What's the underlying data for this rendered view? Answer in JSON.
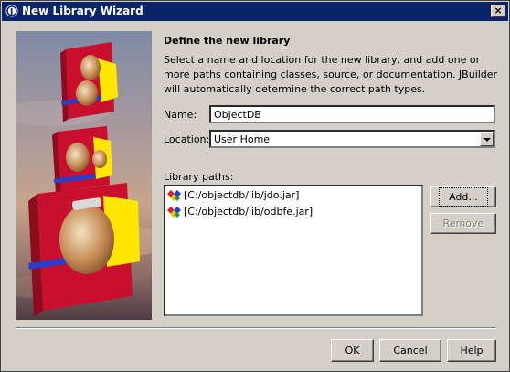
{
  "window": {
    "title": "New Library Wizard"
  },
  "page": {
    "heading": "Define the new library",
    "description": "Select a name and location for the new library, and add one or more paths containing classes, source, or documentation. JBuilder will automatically determine the correct path types."
  },
  "form": {
    "name_label": "Name:",
    "name_value": "ObjectDB",
    "location_label": "Location:",
    "location_value": "User Home"
  },
  "library_paths": {
    "label": "Library paths:",
    "items": [
      {
        "path": "[C:/objectdb/lib/jdo.jar]"
      },
      {
        "path": "[C:/objectdb/lib/odbfe.jar]"
      }
    ],
    "add_label": "Add...",
    "remove_label": "Remove"
  },
  "footer": {
    "ok_label": "OK",
    "cancel_label": "Cancel",
    "help_label": "Help"
  },
  "colors": {
    "title_bar": "#0a246a",
    "dialog_bg": "#d4d0c8",
    "book_red": "#c8102e",
    "book_yellow": "#ffe600"
  },
  "icons": {
    "title": "java-cup-icon",
    "close": "close-icon",
    "library_entry": "library-archive-icon",
    "dropdown": "chevron-down-icon"
  }
}
